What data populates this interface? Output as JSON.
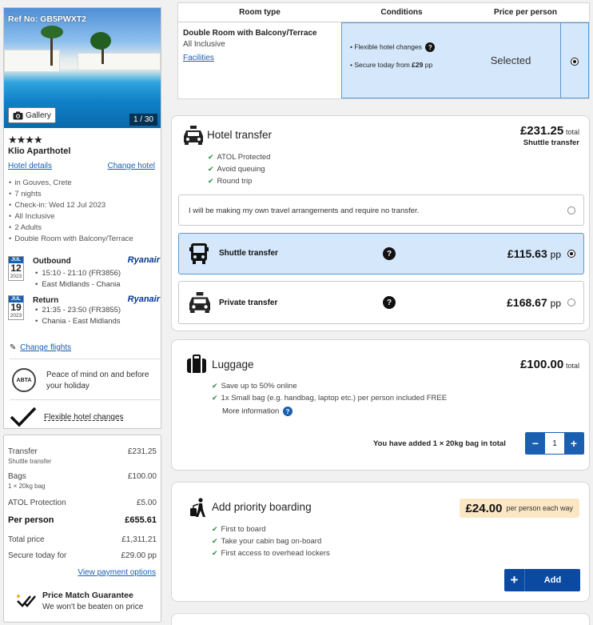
{
  "hotel": {
    "ref": "Ref No: GB5PWXT2",
    "gallery_label": "Gallery",
    "photo_count": "1 / 30",
    "stars": "★★★★",
    "name": "Klio Aparthotel",
    "details_link": "Hotel details",
    "change_link": "Change hotel",
    "facts": [
      "in Gouves, Crete",
      "7 nights",
      "Check-in: Wed 12 Jul 2023",
      "All Inclusive",
      "2 Adults",
      "Double Room with Balcony/Terrace"
    ]
  },
  "flights": {
    "outbound": {
      "month": "JUL",
      "day": "12",
      "year": "2023",
      "label": "Outbound",
      "carrier": "Ryanair",
      "times": "15:10 - 21:10 (FR3856)",
      "route": "East Midlands - Chania"
    },
    "return": {
      "month": "JUL",
      "day": "19",
      "year": "2023",
      "label": "Return",
      "carrier": "Ryanair",
      "times": "21:35 - 23:50 (FR3855)",
      "route": "Chania - East Midlands"
    },
    "change_link": "Change flights"
  },
  "abta": {
    "logo_text": "ABTA",
    "text": "Peace of mind on and before your holiday"
  },
  "flex_changes": "Flexible hotel changes",
  "price_summary": {
    "transfer_label": "Transfer",
    "transfer_sub": "Shuttle transfer",
    "transfer_val": "£231.25",
    "bags_label": "Bags",
    "bags_sub": "1 × 20kg bag",
    "bags_val": "£100.00",
    "atol_label": "ATOL Protection",
    "atol_val": "£5.00",
    "per_person_label": "Per person",
    "per_person_val": "£655.61",
    "total_label": "Total price",
    "total_val": "£1,311.21",
    "secure_label": "Secure today for",
    "secure_val": "£29.00 pp",
    "payment_link": "View payment options",
    "pm_title": "Price Match Guarantee",
    "pm_sub": "We won't be beaten on price"
  },
  "room": {
    "headers": [
      "Room type",
      "Conditions",
      "Price per person"
    ],
    "name": "Double Room with Balcony/Terrace",
    "board": "All Inclusive",
    "facilities": "Facilities",
    "cond1": "Flexible hotel changes",
    "cond2_prefix": "Secure today from",
    "cond2_price": "£29",
    "cond2_suffix": "pp",
    "status": "Selected"
  },
  "transfer": {
    "title": "Hotel transfer",
    "price": "£231.25",
    "price_suffix": "total",
    "selected_type": "Shuttle transfer",
    "features": [
      "ATOL Protected",
      "Avoid queuing",
      "Round trip"
    ],
    "own_arrangements": "I will be making my own travel arrangements and require no transfer.",
    "shuttle_label": "Shuttle transfer",
    "shuttle_price": "£115.63",
    "private_label": "Private transfer",
    "private_price": "£168.67",
    "pp": "pp"
  },
  "luggage": {
    "title": "Luggage",
    "price": "£100.00",
    "price_suffix": "total",
    "features": [
      "Save up to 50% online",
      "1x Small bag (e.g. handbag, laptop etc.) per person included FREE"
    ],
    "more_info": "More information",
    "added_text": "You have added 1 × 20kg bag in total",
    "quantity": "1"
  },
  "priority": {
    "title": "Add priority boarding",
    "price": "£24.00",
    "price_suffix": "per person each way",
    "features": [
      "First to board",
      "Take your cabin bag on-board",
      "First access to overhead lockers"
    ],
    "add_label": "Add"
  },
  "colors": {
    "accent": "#1a5fb0",
    "selected_bg": "#d4e7fb",
    "check": "#2c8a3e",
    "ryanair": "#073590",
    "priority_bg": "#fbe7c4"
  }
}
